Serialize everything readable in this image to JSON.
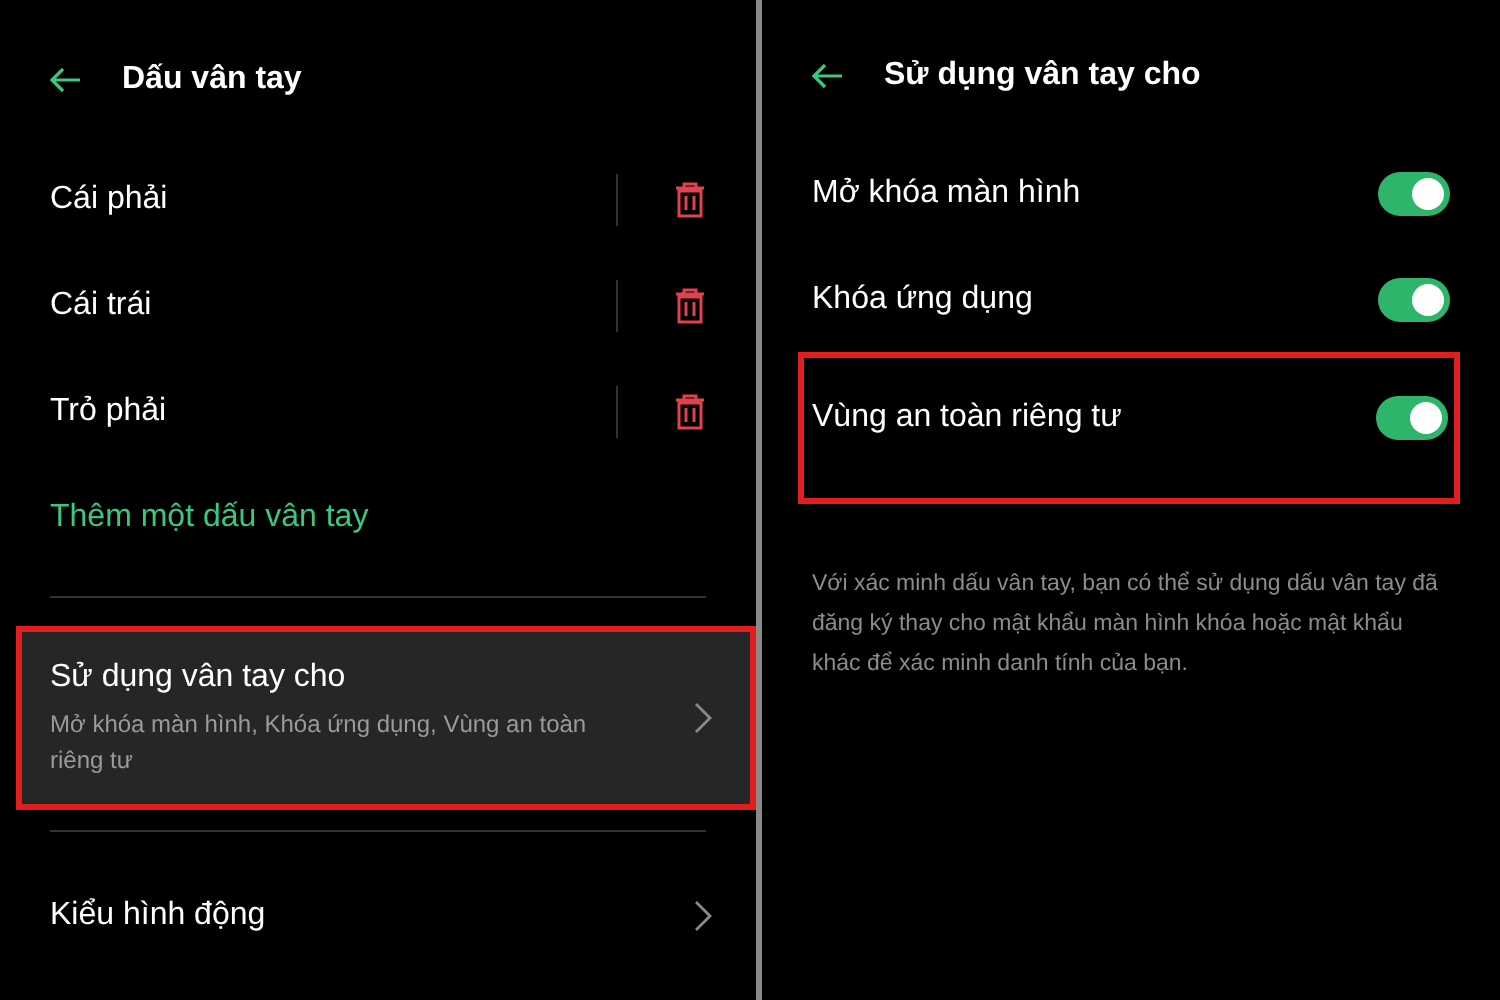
{
  "left": {
    "header": {
      "title": "Dấu vân tay"
    },
    "fingerprints": [
      {
        "name": "Cái phải"
      },
      {
        "name": "Cái trái"
      },
      {
        "name": "Trỏ phải"
      }
    ],
    "add_link": "Thêm một dấu vân tay",
    "menu": [
      {
        "title": "Sử dụng vân tay cho",
        "subtitle": "Mở khóa màn hình, Khóa ứng dụng, Vùng an toàn riêng tư",
        "highlighted": true
      },
      {
        "title": "Kiểu hình động",
        "highlighted": false
      }
    ]
  },
  "right": {
    "header": {
      "title": "Sử dụng vân tay cho"
    },
    "toggles": [
      {
        "label": "Mở khóa màn hình",
        "on": true,
        "highlighted": false
      },
      {
        "label": "Khóa ứng dụng",
        "on": true,
        "highlighted": false
      },
      {
        "label": "Vùng an toàn riêng tư",
        "on": true,
        "highlighted": true
      }
    ],
    "description": "Với xác minh dấu vân tay, bạn có thể sử dụng dấu vân tay đã đăng ký thay cho mật khẩu màn hình khóa hoặc mật khẩu khác để xác minh danh tính của bạn."
  }
}
